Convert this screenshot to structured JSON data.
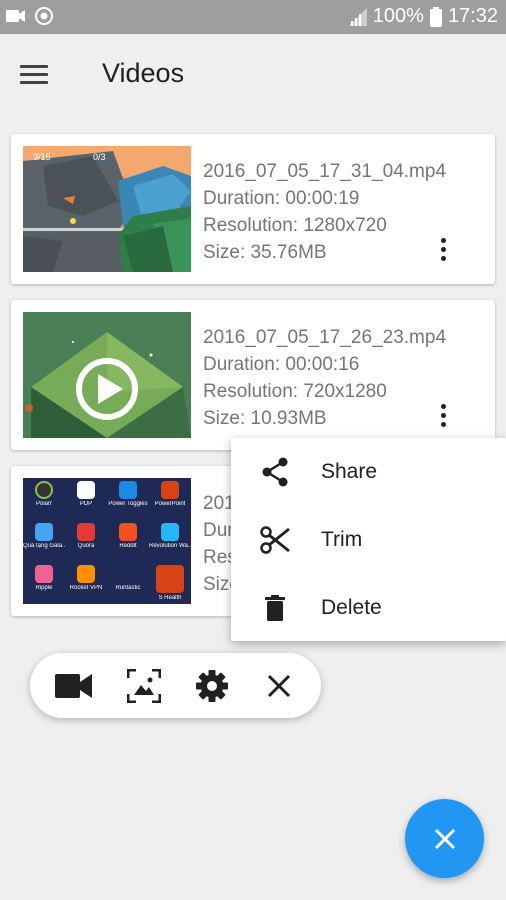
{
  "status_bar": {
    "battery_percent": "100%",
    "time": "17:32",
    "icons": [
      "video-camera-icon",
      "screen-recorder-icon",
      "signal-icon",
      "battery-icon"
    ]
  },
  "app_bar": {
    "title": "Videos",
    "menu_icon": "hamburger-menu-icon"
  },
  "videos": [
    {
      "filename": "2016_07_05_17_31_04.mp4",
      "duration": "Duration: 00:00:19",
      "resolution": "Resolution: 1280x720",
      "size": "Size: 35.76MB",
      "thumb_hud_left": "3/15",
      "thumb_hud_right": "0/3"
    },
    {
      "filename": "2016_07_05_17_26_23.mp4",
      "duration": "Duration: 00:00:16",
      "resolution": "Resolution: 720x1280",
      "size": "Size: 10.93MB"
    },
    {
      "filename": "201",
      "duration": "Dur",
      "resolution": "Res",
      "size": "Size",
      "thumb_apps": [
        "Polarr",
        "PDP",
        "Power Toggles",
        "PowerPoint",
        "Quà tặng Gala...",
        "Quora",
        "Reddit",
        "Revolution Wa...",
        "Ripple",
        "Rocket VPN",
        "Runtastic",
        "S Health"
      ]
    }
  ],
  "context_menu": {
    "items": [
      {
        "label": "Share",
        "icon": "share-icon"
      },
      {
        "label": "Trim",
        "icon": "scissors-icon"
      },
      {
        "label": "Delete",
        "icon": "trash-icon"
      }
    ]
  },
  "floating_toolbar": {
    "buttons": [
      "record-video-icon",
      "screenshot-icon",
      "settings-icon",
      "close-icon"
    ]
  },
  "fab": {
    "icon": "close-icon",
    "color": "#2196f3"
  },
  "colors": {
    "status_bar": "#9e9e9e",
    "background": "#efefef",
    "accent": "#2196f3"
  }
}
